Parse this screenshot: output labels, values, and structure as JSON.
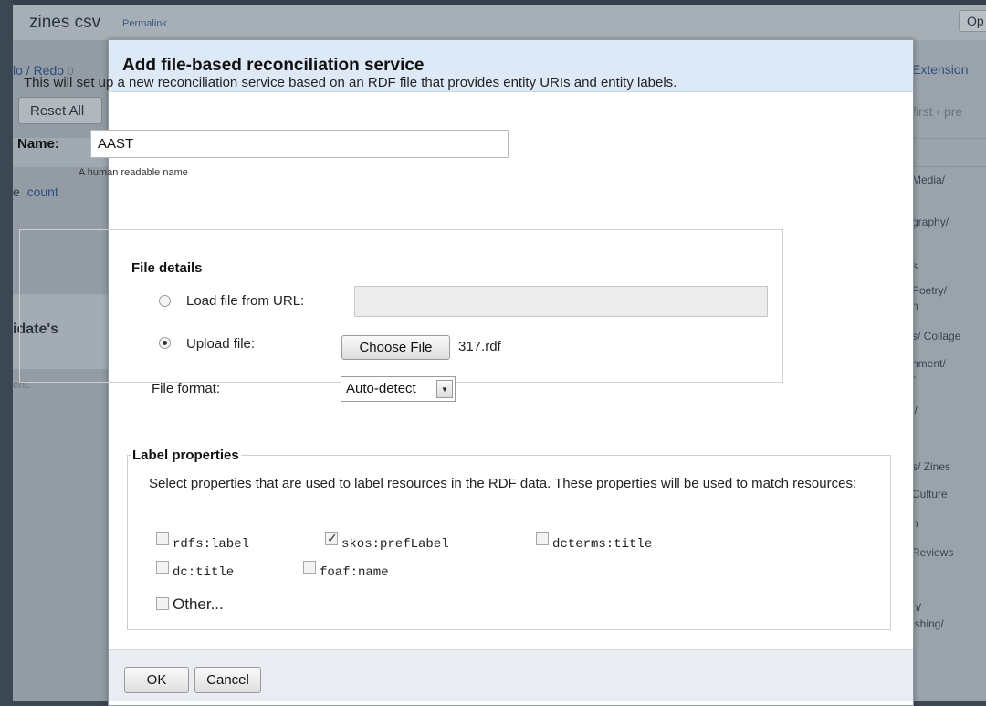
{
  "background": {
    "project_title": "zines csv",
    "permalink": "Permalink",
    "open_button": "Op",
    "undo_redo": "lo / Redo",
    "undo_count": "0",
    "reset_all": "Reset All",
    "count_link": "count",
    "count_prefix": "e",
    "candidate": "idate's",
    "entity_note": "ent.",
    "extensions": "Extension",
    "pager": "first",
    "pager_prev": "‹ pre",
    "right_items": [
      "Media/",
      "graphy/",
      "s",
      "Poetry/",
      "h",
      "s/ Collage",
      "nment/",
      "r",
      "l/",
      "s/ Zines",
      "Culture",
      "n",
      "Reviews",
      "n/",
      "ishing/"
    ]
  },
  "dialog": {
    "title": "Add file-based reconciliation service",
    "intro": "This will set up a new reconciliation service based on an RDF file that provides entity URIs and entity labels.",
    "name": {
      "label": "Name:",
      "value": "AAST",
      "hint": "A human readable name"
    },
    "file_details": {
      "legend": "File details",
      "load_url_label": "Load file from URL:",
      "load_url_value": "",
      "upload_label": "Upload file:",
      "upload_selected": true,
      "choose_file_button": "Choose File",
      "chosen_file": "317.rdf",
      "format_label": "File format:",
      "format_value": "Auto-detect"
    },
    "label_properties": {
      "legend": "Label properties",
      "description": "Select properties that are used to label resources in the RDF data. These properties will be used to match resources:",
      "properties": [
        {
          "name": "rdfs:label",
          "checked": false
        },
        {
          "name": "skos:prefLabel",
          "checked": true
        },
        {
          "name": "dcterms:title",
          "checked": false
        },
        {
          "name": "dc:title",
          "checked": false
        },
        {
          "name": "foaf:name",
          "checked": false
        }
      ],
      "other_label": "Other..."
    },
    "footer": {
      "ok": "OK",
      "cancel": "Cancel"
    }
  }
}
